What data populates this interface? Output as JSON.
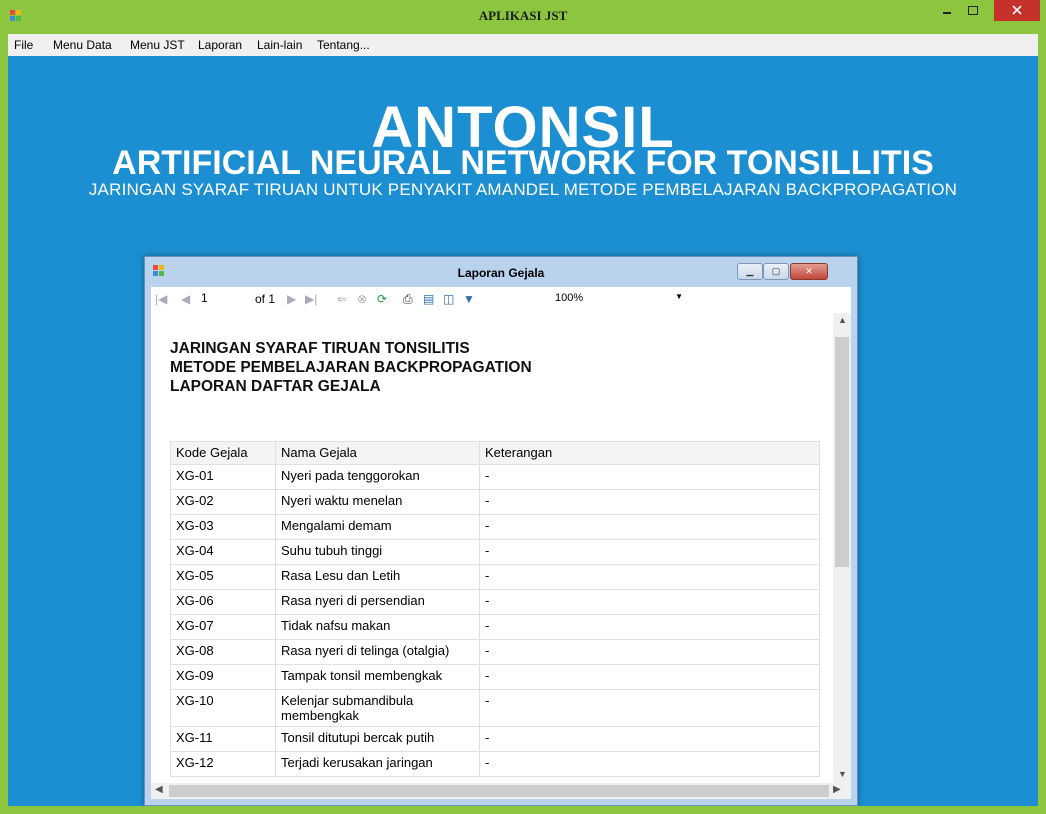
{
  "window": {
    "title": "APLIKASI JST",
    "close_icon": "close-icon",
    "min_icon": "minimize-icon",
    "max_icon": "maximize-icon"
  },
  "menu": [
    "File",
    "Menu Data",
    "Menu JST",
    "Laporan",
    "Lain-lain",
    "Tentang..."
  ],
  "brand": {
    "main": "ANTONSIL",
    "subtitle": "ARTIFICIAL NEURAL NETWORK FOR TONSILLITIS",
    "tagline": "JARINGAN SYARAF TIRUAN UNTUK PENYAKIT AMANDEL METODE PEMBELAJARAN BACKPROPAGATION"
  },
  "report_window": {
    "title": "Laporan Gejala",
    "page_current": "1",
    "page_total_label": "of 1",
    "zoom": "100%"
  },
  "report": {
    "title_lines": [
      "JARINGAN SYARAF TIRUAN TONSILITIS",
      "METODE PEMBELAJARAN BACKPROPAGATION",
      "LAPORAN DAFTAR GEJALA"
    ],
    "columns": [
      "Kode Gejala",
      "Nama Gejala",
      "Keterangan"
    ],
    "rows": [
      [
        "XG-01",
        "Nyeri pada tenggorokan",
        "-"
      ],
      [
        "XG-02",
        "Nyeri waktu menelan",
        "-"
      ],
      [
        "XG-03",
        "Mengalami demam",
        "-"
      ],
      [
        "XG-04",
        "Suhu tubuh tinggi",
        "-"
      ],
      [
        "XG-05",
        "Rasa Lesu dan Letih",
        "-"
      ],
      [
        "XG-06",
        "Rasa nyeri di persendian",
        "-"
      ],
      [
        "XG-07",
        "Tidak nafsu makan",
        "-"
      ],
      [
        "XG-08",
        "Rasa nyeri di telinga (otalgia)",
        "-"
      ],
      [
        "XG-09",
        "Tampak tonsil membengkak",
        "-"
      ],
      [
        "XG-10",
        "Kelenjar submandibula membengkak",
        "-"
      ],
      [
        "XG-11",
        "Tonsil ditutupi bercak putih",
        "-"
      ],
      [
        "XG-12",
        "Terjadi kerusakan jaringan",
        "-"
      ]
    ]
  }
}
